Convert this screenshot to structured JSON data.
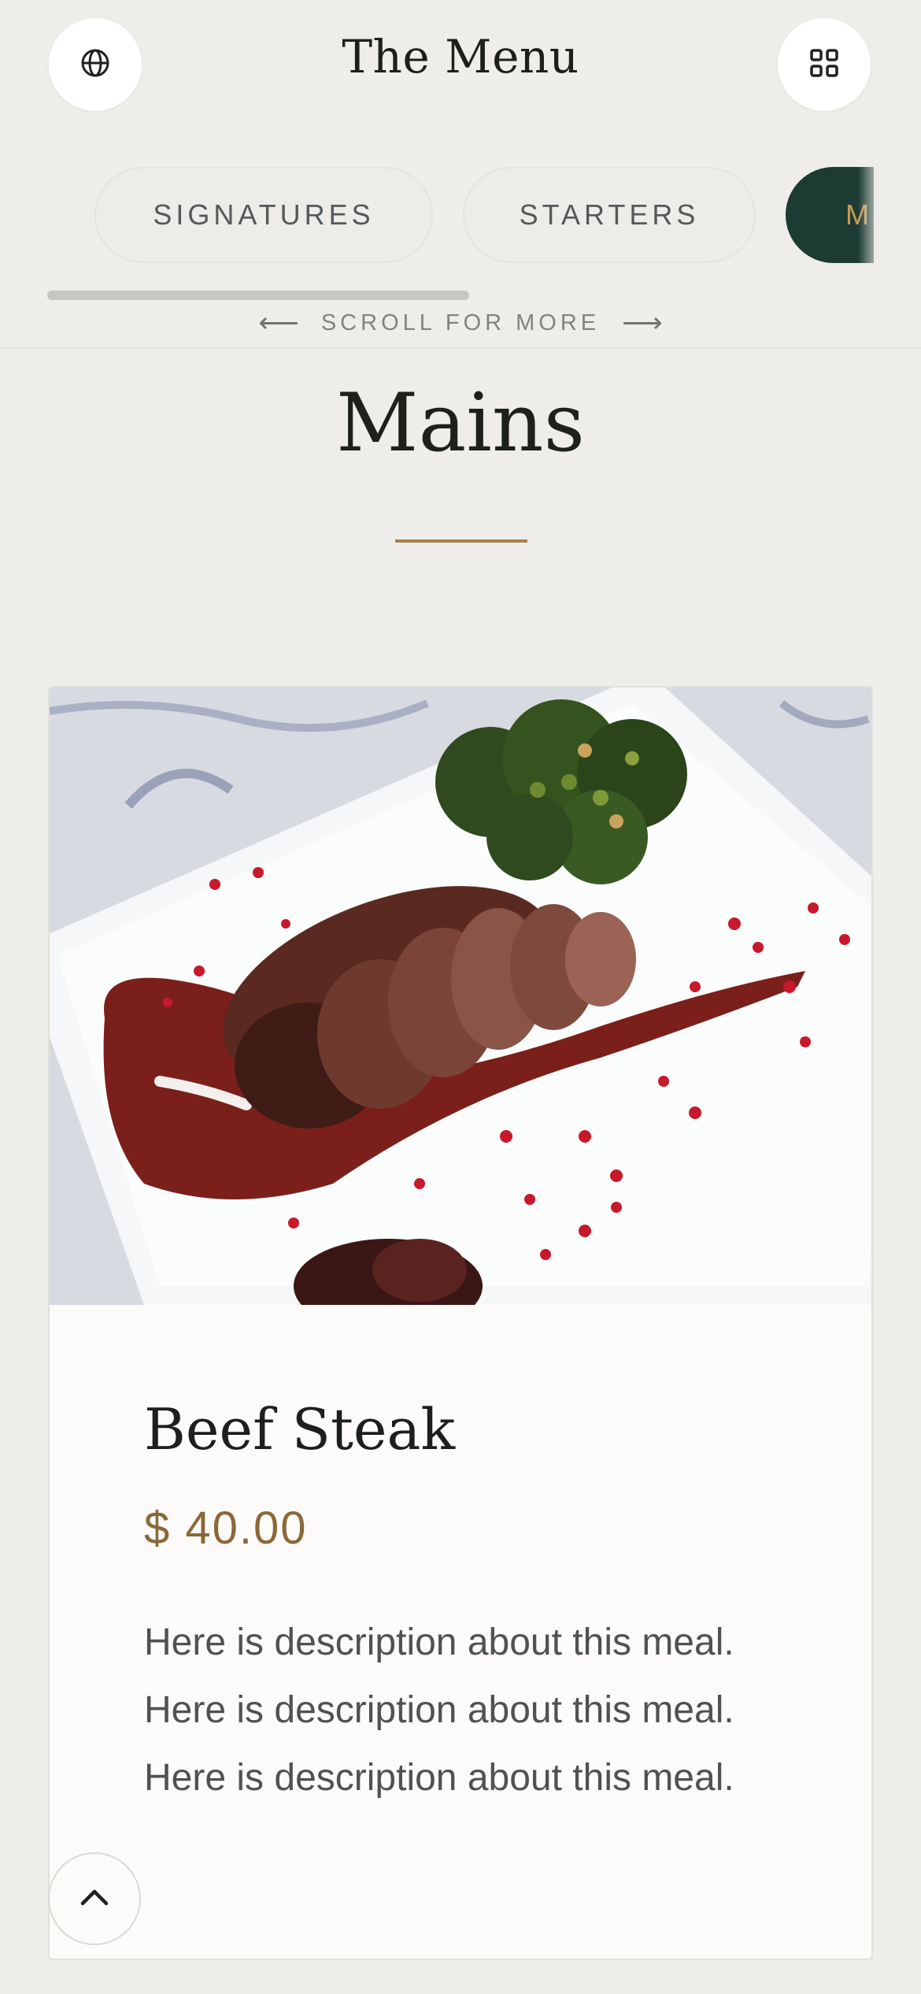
{
  "header": {
    "title": "The Menu",
    "language_icon": "globe-icon",
    "categories_icon": "grid-icon"
  },
  "tabs": [
    {
      "label": "SIGNATURES",
      "active": false
    },
    {
      "label": "STARTERS",
      "active": false
    },
    {
      "label": "MAINS",
      "active": true
    }
  ],
  "scroll_hint": {
    "left_arrow": "⟵",
    "text": "SCROLL FOR MORE",
    "right_arrow": "⟶"
  },
  "section": {
    "title": "Mains"
  },
  "dish": {
    "name": "Beef Steak",
    "price": "$ 40.00",
    "description_lines": [
      "Here is description about this meal.",
      "Here is description about this meal.",
      "Here is description about this meal."
    ]
  },
  "back_to_top_icon": "chevron-up-icon",
  "colors": {
    "background": "#efede9",
    "accent_dark_green": "#1b3b33",
    "accent_gold": "#c59a52",
    "price_brown": "#8b6738"
  }
}
